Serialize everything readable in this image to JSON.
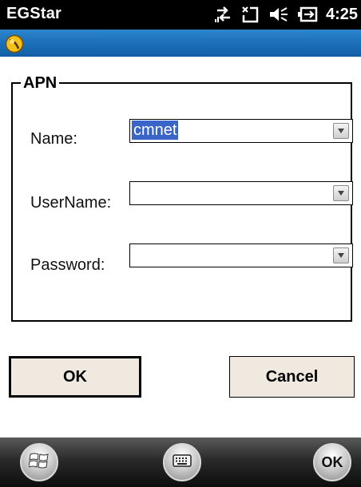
{
  "status_bar": {
    "app_title": "EGStar",
    "time": "4:25",
    "icons": [
      "data-connection-icon",
      "signal-off-icon",
      "volume-icon",
      "battery-icon"
    ]
  },
  "title_strip": {
    "icon": "start-orb-icon",
    "color": "#1b6fb8"
  },
  "apn_group": {
    "title": "APN",
    "fields": [
      {
        "label": "Name:",
        "value": "cmnet"
      },
      {
        "label": "UserName:",
        "value": ""
      },
      {
        "label": "Password:",
        "value": ""
      }
    ]
  },
  "buttons": {
    "ok": "OK",
    "cancel": "Cancel"
  },
  "taskbar": {
    "start_icon": "windows-logo-icon",
    "keyboard_icon": "keyboard-icon",
    "ok_label": "OK"
  },
  "colors": {
    "selection": "#3a64c8",
    "button_face": "#efe9df",
    "status_bar": "#000000"
  }
}
